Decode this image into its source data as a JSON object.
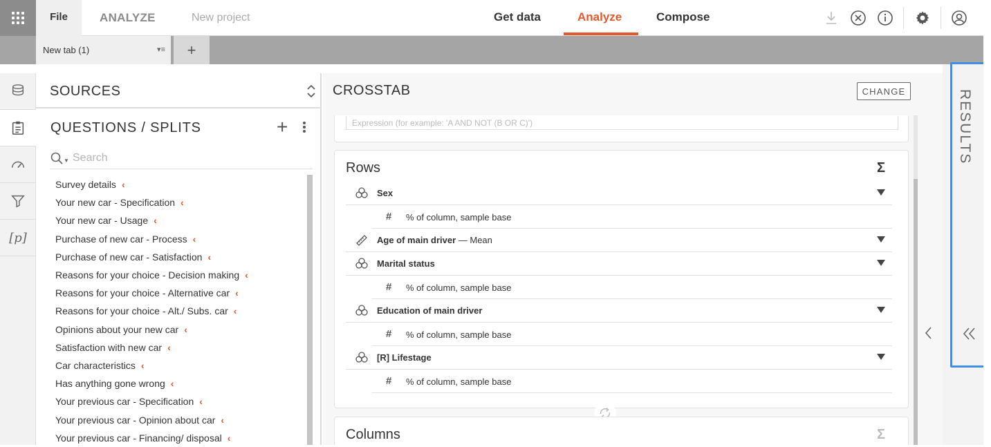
{
  "topbar": {
    "file_label": "File",
    "module_label": "ANALYZE",
    "project_label": "New project",
    "nav": [
      "Get data",
      "Analyze",
      "Compose"
    ],
    "accent_color": "#e05a2b"
  },
  "tabs": {
    "active_tab": "New tab (1)",
    "add_label": "+"
  },
  "left": {
    "sources_title": "SOURCES",
    "questions_title": "QUESTIONS / SPLITS",
    "search_placeholder": "Search",
    "questions": [
      "Survey details",
      "Your new car - Specification",
      "Your new car - Usage",
      "Purchase of new car - Process",
      "Purchase of new car - Satisfaction",
      "Reasons for your choice - Decision making",
      "Reasons for your choice - Alternative car",
      "Reasons for your choice - Alt./ Subs. car",
      "Opinions about your new car",
      "Satisfaction with new car",
      "Car characteristics",
      "Has anything gone wrong",
      "Your previous car - Specification",
      "Your previous car - Opinion about car",
      "Your previous car - Financing/ disposal"
    ]
  },
  "crosstab": {
    "title": "CROSSTAB",
    "change_label": "CHANGE",
    "expression_placeholder": "Expression (for example: 'A AND NOT (B OR C)')",
    "rows_title": "Rows",
    "columns_title": "Columns",
    "sigma": "Σ",
    "rows": [
      {
        "name": "Sex",
        "suffix": "",
        "stat": "% of column, sample base"
      },
      {
        "name": "Age of main driver",
        "suffix": " — Mean",
        "stat": ""
      },
      {
        "name": "Marital status",
        "suffix": "",
        "stat": "% of column, sample base"
      },
      {
        "name": "Education of main driver",
        "suffix": "",
        "stat": "% of column, sample base"
      },
      {
        "name": "[R] Lifestage",
        "suffix": "",
        "stat": "% of column, sample base"
      }
    ]
  },
  "results": {
    "label": "RESULTS",
    "highlight_color": "#3d8ee8"
  }
}
